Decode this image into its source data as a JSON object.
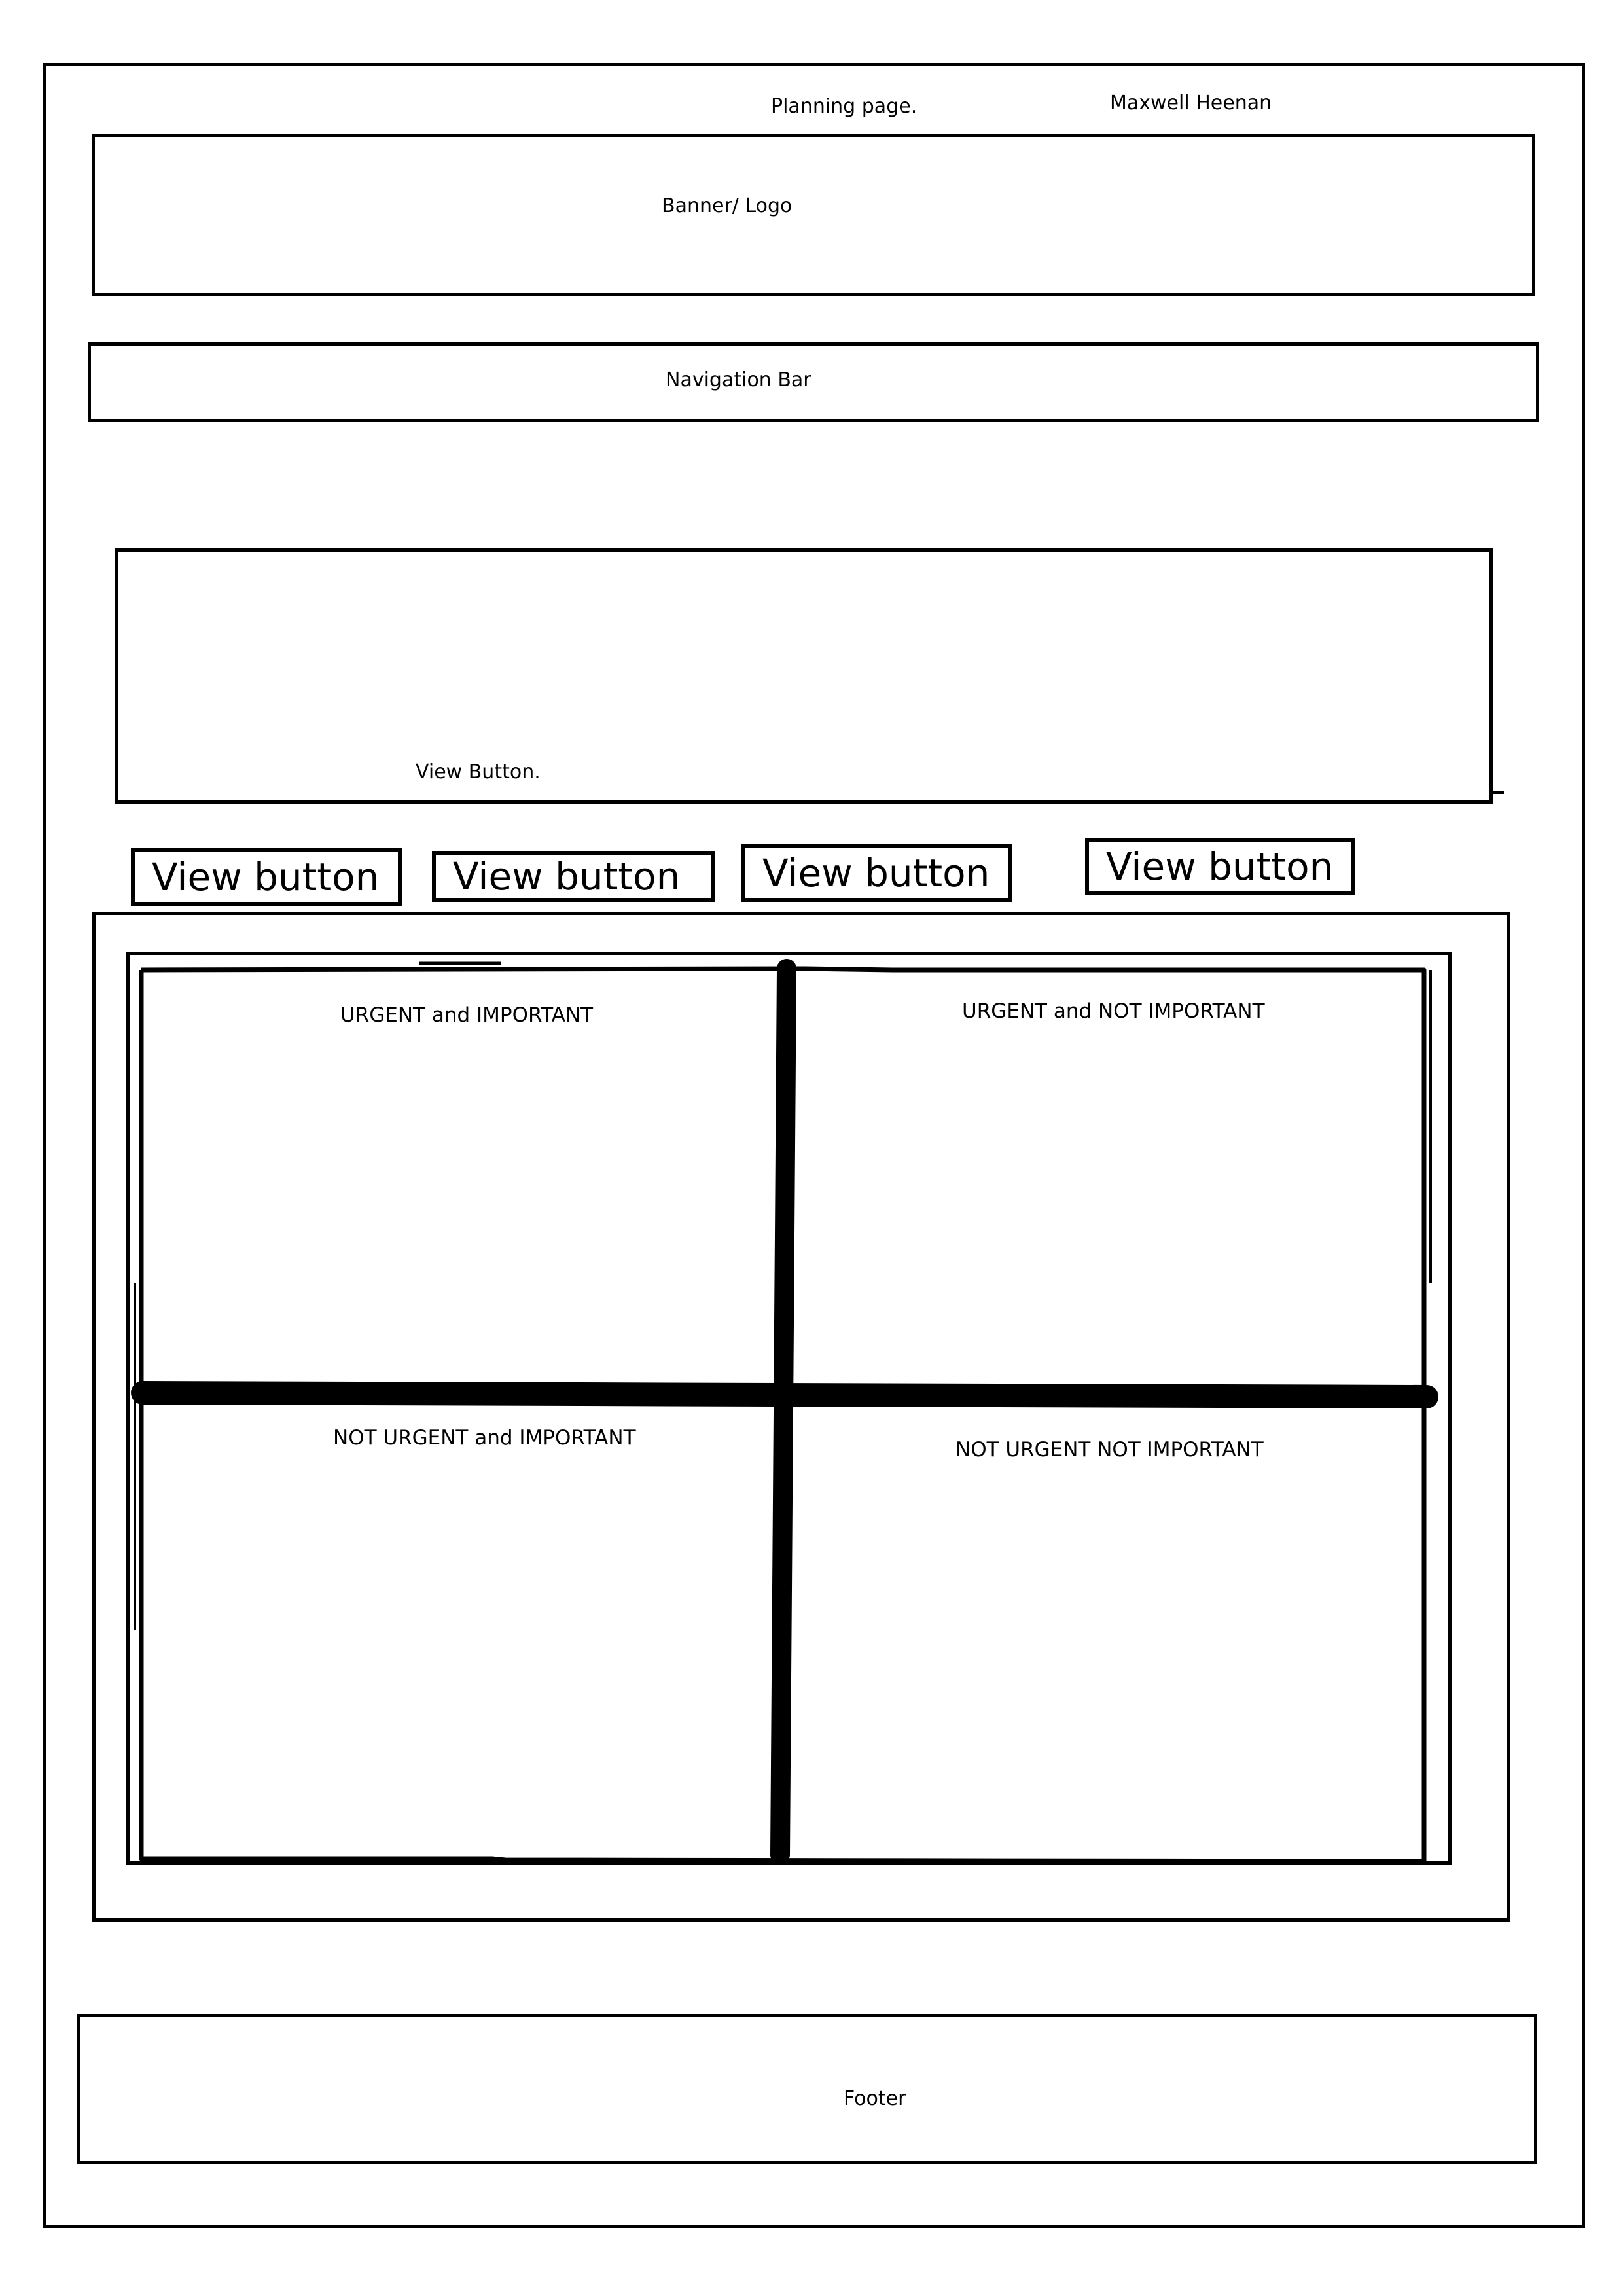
{
  "header": {
    "page_label": "Planning page.",
    "author": "Maxwell Heenan"
  },
  "banner": {
    "label": "Banner/ Logo"
  },
  "navigation": {
    "label": "Navigation Bar"
  },
  "view_panel": {
    "label": "View Button."
  },
  "view_buttons": [
    {
      "label": "View button"
    },
    {
      "label": "View button"
    },
    {
      "label": "View button"
    },
    {
      "label": "View button"
    }
  ],
  "matrix": {
    "quadrants": [
      {
        "label": "URGENT and IMPORTANT"
      },
      {
        "label": "URGENT and NOT IMPORTANT"
      },
      {
        "label": "NOT URGENT and IMPORTANT"
      },
      {
        "label": "NOT URGENT NOT IMPORTANT"
      }
    ]
  },
  "footer": {
    "label": "Footer"
  }
}
